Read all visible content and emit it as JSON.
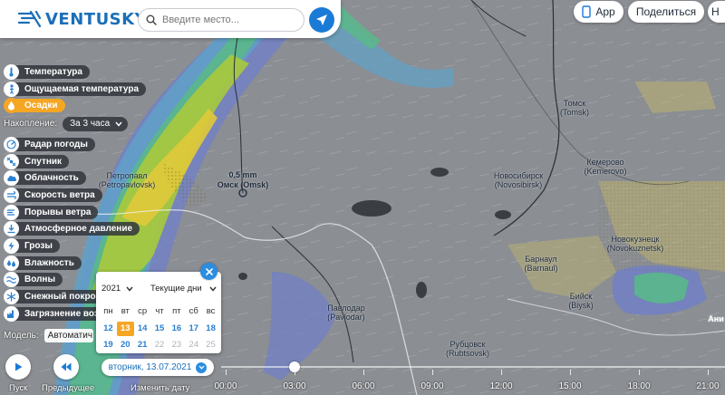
{
  "header": {
    "logo_text": "VENTUSKY",
    "search_placeholder": "Введите место...",
    "app_label": "App",
    "share_label": "Поделиться",
    "next_label": "Н"
  },
  "layers": [
    {
      "label": "Температура",
      "icon": "thermometer-icon"
    },
    {
      "label": "Ощущаемая температура",
      "icon": "person-temperature-icon"
    },
    {
      "label": "Осадки",
      "icon": "raindrop-icon",
      "active": true
    },
    {
      "label": "Радар погоды",
      "icon": "radar-icon"
    },
    {
      "label": "Спутник",
      "icon": "satellite-icon"
    },
    {
      "label": "Облачность",
      "icon": "cloud-icon"
    },
    {
      "label": "Скорость ветра",
      "icon": "wind-icon"
    },
    {
      "label": "Порывы ветра",
      "icon": "wind-gust-icon"
    },
    {
      "label": "Атмосферное давление",
      "icon": "pressure-gauge-icon"
    },
    {
      "label": "Грозы",
      "icon": "lightning-icon"
    },
    {
      "label": "Влажность",
      "icon": "humidity-icon"
    },
    {
      "label": "Волны",
      "icon": "waves-icon"
    },
    {
      "label": "Снежный покров",
      "icon": "snowflake-icon"
    },
    {
      "label": "Загрязнение воз",
      "icon": "pollution-icon"
    }
  ],
  "accumulation": {
    "label": "Накопление:",
    "value": "За 3 часа"
  },
  "model": {
    "label": "Модель:",
    "value": "Автоматич"
  },
  "map": {
    "omsk_value": "0,5 mm",
    "cities": [
      {
        "name": "Петропавл",
        "latin": "(Petropavlovsk)"
      },
      {
        "name": "Омск (Omsk)",
        "latin": "",
        "bold": true
      },
      {
        "name": "Новосибирск",
        "latin": "(Novosibirsk)"
      },
      {
        "name": "Томск",
        "latin": "(Tomsk)"
      },
      {
        "name": "Кемерово",
        "latin": "(Kemerovo)"
      },
      {
        "name": "Новокузнецк",
        "latin": "(Novokuznetsk)"
      },
      {
        "name": "Барнаул",
        "latin": "(Barnaul)"
      },
      {
        "name": "Бийск",
        "latin": "(Biysk)"
      },
      {
        "name": "Павлодар",
        "latin": "(Pavlodar)"
      },
      {
        "name": "Рубцовск",
        "latin": "(Rubtsovsk)"
      },
      {
        "name": "Ани",
        "latin": ""
      }
    ]
  },
  "calendar": {
    "year": "2021",
    "mode": "Текущие дни",
    "weekdays": [
      "пн",
      "вт",
      "ср",
      "чт",
      "пт",
      "сб",
      "вс"
    ],
    "weeks": [
      [
        "12",
        "13",
        "14",
        "15",
        "16",
        "17",
        "18"
      ],
      [
        "19",
        "20",
        "21",
        "22",
        "23",
        "24",
        "25"
      ]
    ],
    "today": "13",
    "available": [
      "12",
      "14",
      "15",
      "16",
      "17",
      "18",
      "19",
      "20",
      "21"
    ]
  },
  "timeline": {
    "play_label": "Пуск",
    "prev_label": "Предыдущее",
    "date_label": "вторник, 13.07.2021",
    "change_date_label": "Изменить дату",
    "hours": [
      "00:00",
      "03:00",
      "06:00",
      "09:00",
      "12:00",
      "15:00",
      "18:00",
      "21:00"
    ]
  },
  "colors": {
    "accent": "#1b6fb8",
    "active_layer": "#f5a623",
    "today": "#f5a623"
  }
}
